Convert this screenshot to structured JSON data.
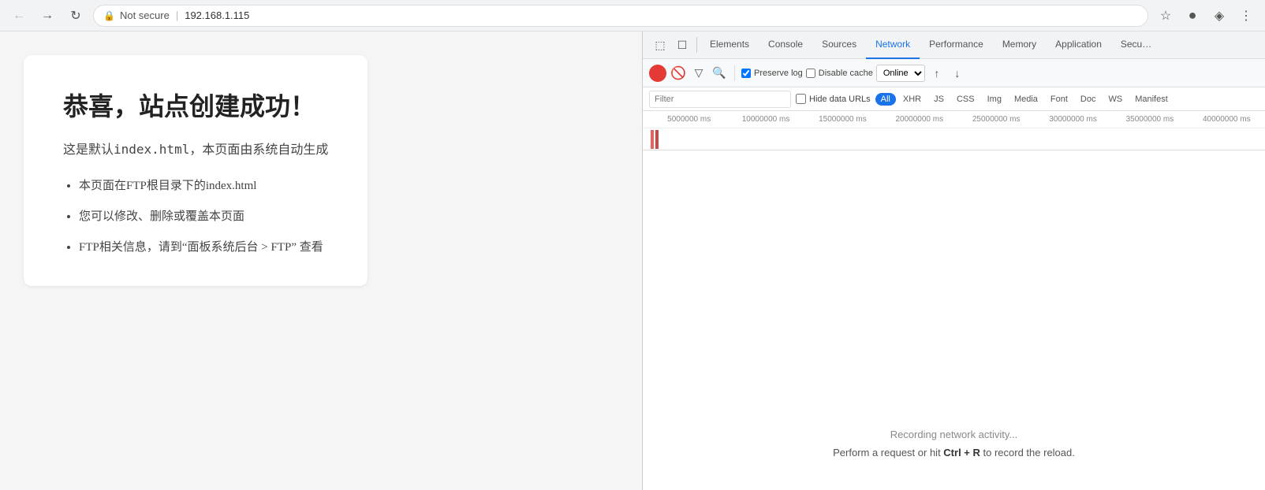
{
  "browser": {
    "back_btn": "←",
    "forward_btn": "→",
    "reload_btn": "↻",
    "not_secure": "Not secure",
    "separator": "|",
    "url": "192.168.1.115",
    "star_icon": "☆",
    "profile_icon": "●",
    "extension_icon": "◈",
    "chrome_icon": "◎"
  },
  "page": {
    "title": "恭喜，站点创建成功！",
    "subtitle": "这是默认index.html，本页面由系统自动生成",
    "list_items": [
      "本页面在FTP根目录下的index.html",
      "您可以修改、删除或覆盖本页面",
      "FTP相关信息，请到“面板系统后台 > FTP” 查看"
    ]
  },
  "devtools": {
    "inspect_icon": "⬚",
    "device_icon": "☐",
    "tabs": [
      {
        "label": "Elements",
        "active": false
      },
      {
        "label": "Console",
        "active": false
      },
      {
        "label": "Sources",
        "active": false
      },
      {
        "label": "Network",
        "active": true
      },
      {
        "label": "Performance",
        "active": false
      },
      {
        "label": "Memory",
        "active": false
      },
      {
        "label": "Application",
        "active": false
      },
      {
        "label": "Security",
        "active": false
      }
    ],
    "toolbar": {
      "record_title": "Record",
      "stop_title": "Stop",
      "filter_title": "Filter",
      "search_title": "Search",
      "preserve_log_label": "Preserve log",
      "preserve_log_checked": true,
      "disable_cache_label": "Disable cache",
      "disable_cache_checked": false,
      "online_label": "Online",
      "upload_icon": "↑",
      "download_icon": "↓"
    },
    "filter_bar": {
      "placeholder": "Filter",
      "hide_data_label": "Hide data URLs",
      "tags": [
        {
          "label": "All",
          "active": true
        },
        {
          "label": "XHR",
          "active": false
        },
        {
          "label": "JS",
          "active": false
        },
        {
          "label": "CSS",
          "active": false
        },
        {
          "label": "Img",
          "active": false
        },
        {
          "label": "Media",
          "active": false
        },
        {
          "label": "Font",
          "active": false
        },
        {
          "label": "Doc",
          "active": false
        },
        {
          "label": "WS",
          "active": false
        },
        {
          "label": "Manifest",
          "active": false
        }
      ]
    },
    "timeline": {
      "labels": [
        "5000000 ms",
        "10000000 ms",
        "15000000 ms",
        "20000000 ms",
        "25000000 ms",
        "30000000 ms",
        "35000000 ms",
        "40000000 ms"
      ]
    },
    "empty_state": {
      "main_text": "Recording network activity...",
      "sub_text": "Perform a request or hit ",
      "shortcut": "Ctrl + R",
      "sub_text2": " to record the reload."
    }
  }
}
